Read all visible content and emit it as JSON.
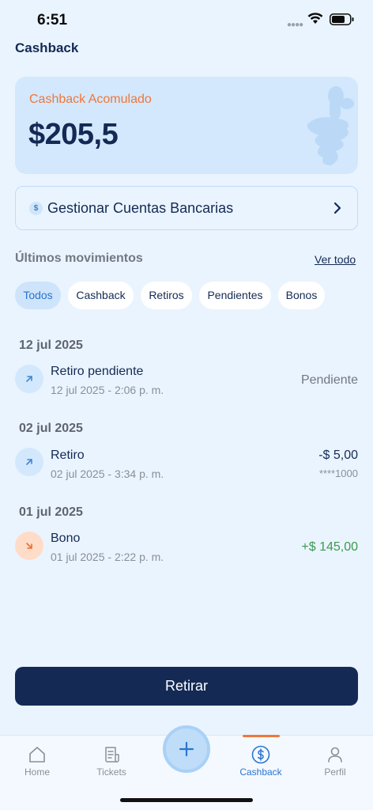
{
  "status_bar": {
    "time": "6:51"
  },
  "header": {
    "title": "Cashback"
  },
  "balance": {
    "label": "Cashback Acomulado",
    "amount": "$205,5"
  },
  "bank_accounts": {
    "label": "Gestionar Cuentas Bancarias",
    "icon": "dollar-coin-icon"
  },
  "movements": {
    "title": "Últimos movimientos",
    "view_all": "Ver todo",
    "filters": [
      "Todos",
      "Cashback",
      "Retiros",
      "Pendientes",
      "Bonos"
    ],
    "active_filter": "Todos",
    "groups": [
      {
        "date": "12 jul 2025",
        "items": [
          {
            "title": "Retiro pendiente",
            "datetime": "12 jul 2025 - 2:06 p. m.",
            "status": "Pendiente",
            "icon": "arrow-up-right-icon"
          }
        ]
      },
      {
        "date": "02 jul 2025",
        "items": [
          {
            "title": "Retiro",
            "datetime": "02 jul 2025 - 3:34 p. m.",
            "amount": "-$ 5,00",
            "account": "****1000",
            "icon": "arrow-up-right-icon"
          }
        ]
      },
      {
        "date": "01 jul 2025",
        "items": [
          {
            "title": "Bono",
            "datetime": "01 jul 2025 - 2:22 p. m.",
            "amount": "+$ 145,00",
            "icon": "arrow-down-right-icon"
          }
        ]
      }
    ]
  },
  "actions": {
    "withdraw": "Retirar"
  },
  "tab_bar": {
    "items": [
      {
        "label": "Home",
        "icon": "home-icon"
      },
      {
        "label": "Tickets",
        "icon": "receipt-icon"
      },
      {
        "label": "",
        "icon": "plus-icon"
      },
      {
        "label": "Cashback",
        "icon": "dollar-circle-icon"
      },
      {
        "label": "Perfil",
        "icon": "user-icon"
      }
    ],
    "active": "Cashback"
  },
  "colors": {
    "primary": "#142A55",
    "accent": "#F0763A",
    "active_blue": "#2B74D0",
    "background": "#EAF4FE",
    "positive": "#3C9A4D"
  }
}
